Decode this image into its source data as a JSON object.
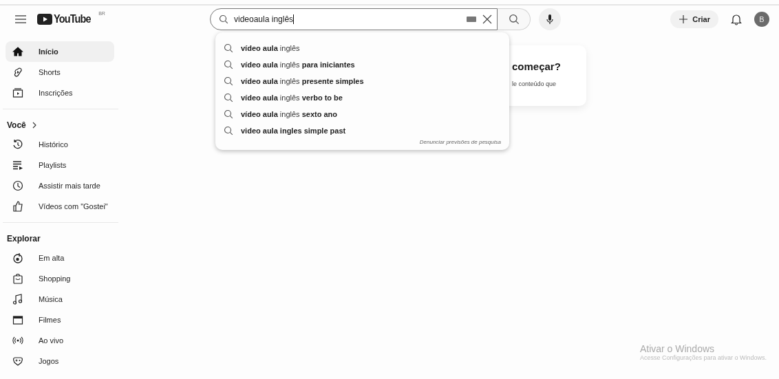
{
  "header": {
    "logo": "YouTube",
    "country": "BR",
    "search": {
      "value": "videoaula inglês"
    },
    "create_label": "Criar",
    "avatar": "B"
  },
  "sidebar": {
    "sections": [
      {
        "items": [
          {
            "label": "Início",
            "selected": true
          },
          {
            "label": "Shorts",
            "selected": false
          },
          {
            "label": "Inscrições",
            "selected": false
          }
        ]
      },
      {
        "heading": "Você",
        "items": [
          {
            "label": "Histórico",
            "selected": false
          },
          {
            "label": "Playlists",
            "selected": false
          },
          {
            "label": "Assistir mais tarde",
            "selected": false
          },
          {
            "label": "Vídeos com \"Gostei\"",
            "selected": false
          }
        ]
      },
      {
        "heading": "Explorar",
        "items": [
          {
            "label": "Em alta",
            "selected": false
          },
          {
            "label": "Shopping",
            "selected": false
          },
          {
            "label": "Música",
            "selected": false
          },
          {
            "label": "Filmes",
            "selected": false
          },
          {
            "label": "Ao vivo",
            "selected": false
          },
          {
            "label": "Jogos",
            "selected": false
          }
        ]
      }
    ]
  },
  "suggestions": {
    "items": [
      "**vídeo aula** inglês",
      "**vídeo aula** inglês **para iniciantes**",
      "**vídeo aula** inglês **presente simples**",
      "**vídeo aula** inglês **verbo to be**",
      "**vídeo aula** inglês **sexto ano**",
      "**video aula ingles simple past**"
    ],
    "report_link": "Denunciar previsões de pesquisa"
  },
  "card": {
    "title": "começar?",
    "text": "le conteúdo que"
  },
  "windows_notice": {
    "title": "Ativar o Windows",
    "text": "Acesse Configurações para ativar o Windows."
  }
}
